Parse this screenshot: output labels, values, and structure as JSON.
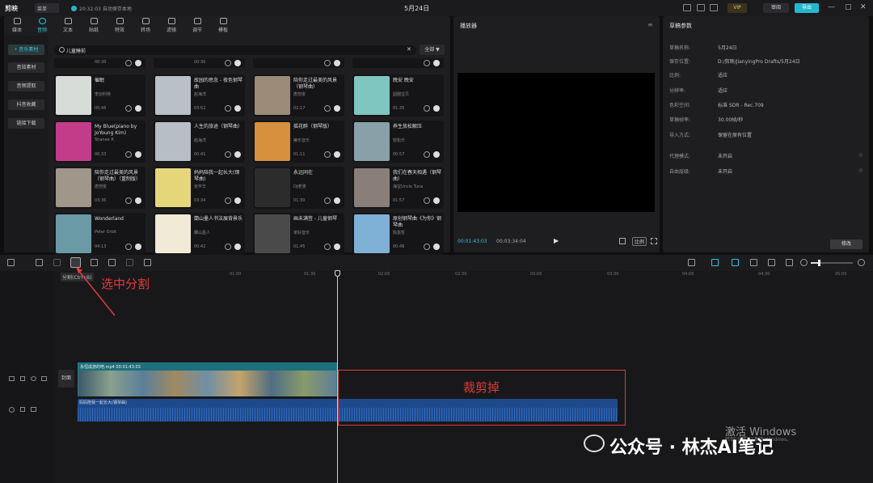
{
  "title_bar": {
    "logo": "剪映",
    "menu": "菜单",
    "autosave": "20:32:03 自动保存本地",
    "project_title": "5月24日",
    "vip": "VIP",
    "review": "审阅",
    "export": "导出",
    "minimize": "—",
    "maximize": "▢",
    "close": "✕"
  },
  "media": {
    "tabs": [
      "媒体",
      "音频",
      "文本",
      "贴纸",
      "特效",
      "转场",
      "滤镜",
      "调节",
      "模板"
    ],
    "active_tab": 1,
    "sidenav": [
      "• 音乐素材",
      "音效素材",
      "音频提取",
      "抖音收藏",
      "链接下载"
    ],
    "search": {
      "value": "儿童睡前"
    },
    "filter": "全部 ▼",
    "partial_durations": [
      "00:30",
      "00:30",
      "",
      ""
    ],
    "cards": [
      {
        "title": "催眠",
        "artist": "李创利特",
        "duration": "00:46",
        "thumb": "#d8dcd8"
      },
      {
        "title": "故园的思念 - 夜色钢琴曲",
        "artist": "赵海洋",
        "duration": "03:52",
        "thumb": "#b9c1c6"
      },
      {
        "title": "陪你走过最美的风景（钢琴曲）",
        "artist": "唐恺俊",
        "duration": "02:17",
        "thumb": "#9c8a78"
      },
      {
        "title": "晚安 晚安",
        "artist": "圆圈宝贝",
        "duration": "01:35",
        "thumb": "#7fc6c1"
      },
      {
        "title": "My Blue(piano by JoYoung Kim)",
        "artist": "Shanee R",
        "duration": "00:33",
        "thumb": "#c23c8a"
      },
      {
        "title": "人生的旅途（钢琴曲）",
        "artist": "赵海洋",
        "duration": "00:41",
        "thumb": "#b8bfc4"
      },
      {
        "title": "摇花醉（钢琴版）",
        "artist": "蒂乐音乐",
        "duration": "01:11",
        "thumb": "#d6903e"
      },
      {
        "title": "养生放松解压",
        "artist": "轻松乐",
        "duration": "00:57",
        "thumb": "#8aa0a8"
      },
      {
        "title": "陪你走过最美的风景（钢琴曲）（重制版）",
        "artist": "唐恺俊",
        "duration": "03:36",
        "thumb": "#a0968a"
      },
      {
        "title": "妈妈陪我一起长大(钢琴曲)",
        "artist": "张宇华",
        "duration": "03:34",
        "thumb": "#e6d67a"
      },
      {
        "title": "永远同在",
        "artist": "DJ老骑",
        "duration": "01:30",
        "thumb": "#2c2c2c"
      },
      {
        "title": "我们在春天相遇（钢琴曲）",
        "artist": "海宝Uncle Tuna",
        "duration": "01:57",
        "thumb": "#8a7f78"
      },
      {
        "title": "Wonderland",
        "artist": "Peter Orbit",
        "duration": "04:13",
        "thumb": "#6a9aa6"
      },
      {
        "title": "蘭山墨人书法展背景乐",
        "artist": "蘭山墨人",
        "duration": "00:42",
        "thumb": "#f0ead6"
      },
      {
        "title": "画未满签 - 儿童钢琴",
        "artist": "家好音乐",
        "duration": "01:45",
        "thumb": "#4a4a4a"
      },
      {
        "title": "原创钢琴曲《为你》钢琴曲",
        "artist": "陈嘉哲",
        "duration": "00:46",
        "thumb": "#7fb0d6"
      }
    ]
  },
  "player": {
    "title": "播放器",
    "menu": "≡",
    "current_time": "00:01:43:03",
    "total_time": "00:03:34:04",
    "play": "▶",
    "ratio": "比例"
  },
  "draft": {
    "title": "草稿参数",
    "rows": [
      {
        "label": "草稿名称:",
        "value": "5月24日"
      },
      {
        "label": "保存位置:",
        "value": "D:/剪映/JianyingPro Drafts/5月24日"
      },
      {
        "label": "比例:",
        "value": "适应"
      },
      {
        "label": "分辨率:",
        "value": "适应"
      },
      {
        "label": "色彩空间:",
        "value": "标准 SDR - Rec.709"
      },
      {
        "label": "草稿帧率:",
        "value": "30.00帧/秒"
      },
      {
        "label": "导入方式:",
        "value": "保留在原有位置"
      },
      {
        "label": "代理模式:",
        "value": "未开启"
      },
      {
        "label": "自由层级:",
        "value": "未开启"
      }
    ],
    "modify": "修改"
  },
  "timeline": {
    "ticks": [
      "00:00",
      "01:00",
      "01:30",
      "02:00",
      "02:30",
      "03:00",
      "03:30",
      "04:00",
      "04:30",
      "05:00"
    ],
    "split_tooltip": "分割(Ctrl+B)",
    "cover": "封面",
    "video_clip": {
      "name": "永恒成游的吧.mp4",
      "duration": "00:01:43:03"
    },
    "audio_clip": {
      "name": "妈妈陪我一起长大(钢琴曲)"
    }
  },
  "annotations": {
    "split": "选中分割",
    "trim": "裁剪掉"
  },
  "watermark": {
    "line1": "激活 Windows",
    "line2": "转到\"设置\"以激活 Windows。",
    "wechat": "公众号 · 林杰AI笔记"
  }
}
